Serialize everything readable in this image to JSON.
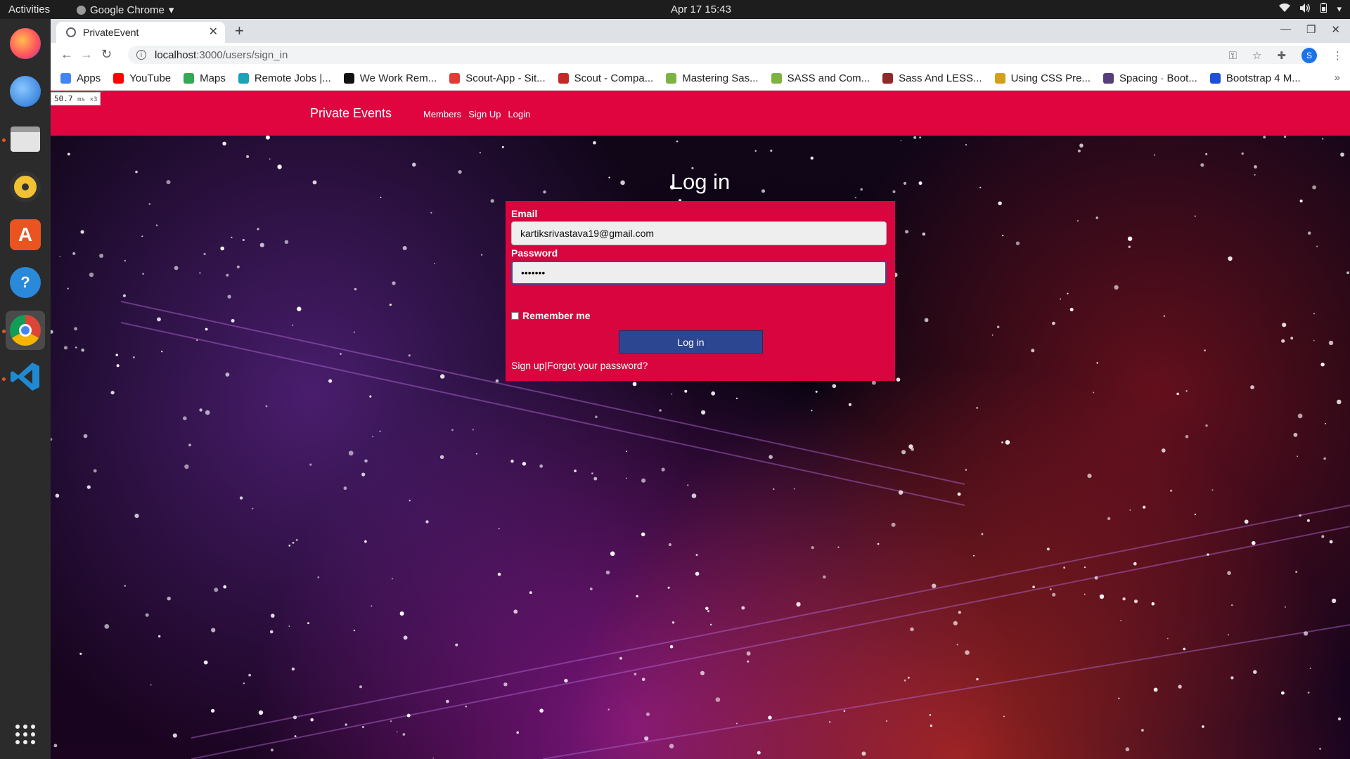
{
  "os": {
    "activities_label": "Activities",
    "app_menu_label": "Google Chrome",
    "clock": "Apr 17  15:43"
  },
  "browser": {
    "tab_title": "PrivateEvent",
    "url_host": "localhost",
    "url_path": ":3000/users/sign_in",
    "profile_initial": "S",
    "bookmarks": [
      {
        "label": "Apps",
        "color": "#4285f4"
      },
      {
        "label": "YouTube",
        "color": "#ff0000"
      },
      {
        "label": "Maps",
        "color": "#34a853"
      },
      {
        "label": "Remote Jobs |...",
        "color": "#1aa3b8"
      },
      {
        "label": "We Work Rem...",
        "color": "#111111"
      },
      {
        "label": "Scout-App - Sit...",
        "color": "#e53935"
      },
      {
        "label": "Scout - Compa...",
        "color": "#c62828"
      },
      {
        "label": "Mastering Sas...",
        "color": "#7cb342"
      },
      {
        "label": "SASS and Com...",
        "color": "#7cb342"
      },
      {
        "label": "Sass And LESS...",
        "color": "#8e2a2a"
      },
      {
        "label": "Using CSS Pre...",
        "color": "#d4a017"
      },
      {
        "label": "Spacing · Boot...",
        "color": "#563d7c"
      },
      {
        "label": "Bootstrap 4 M...",
        "color": "#1e4fd6"
      }
    ]
  },
  "perf": {
    "value": "50.7",
    "unit": "ms",
    "mult": "×3"
  },
  "site": {
    "brand": "Private Events",
    "nav": [
      "Members",
      "Sign Up",
      "Login"
    ],
    "nav_color": "#e0053f"
  },
  "login": {
    "title": "Log in",
    "email_label": "Email",
    "email_value": "kartiksrivastava19@gmail.com",
    "password_label": "Password",
    "password_value": "•••••••",
    "remember_label": "Remember me",
    "submit_label": "Log in",
    "signup_link": "Sign up",
    "separator": "|",
    "forgot_link": "Forgot your password?",
    "card_color": "#d8053e",
    "button_color": "#2c4691"
  }
}
